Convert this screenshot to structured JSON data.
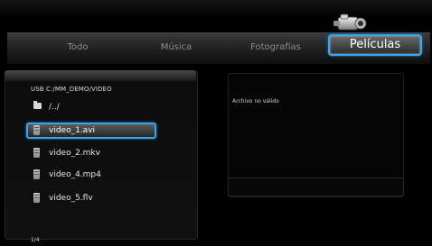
{
  "tabs": [
    {
      "label": "Todo"
    },
    {
      "label": "Música"
    },
    {
      "label": "Fotografías"
    },
    {
      "label": "Películas"
    }
  ],
  "active_tab": "Películas",
  "browser": {
    "path": "USB  C:/MM_DEMO/VIDEO",
    "items": [
      {
        "label": "/../",
        "icon": "folder-icon"
      },
      {
        "label": "video_1.avi",
        "icon": "video-file-icon"
      },
      {
        "label": "video_2.mkv",
        "icon": "video-file-icon"
      },
      {
        "label": "video_4.mp4",
        "icon": "video-file-icon"
      },
      {
        "label": "video_5.flv",
        "icon": "video-file-icon"
      }
    ],
    "selected_item": "video_1.avi",
    "page": "1/4"
  },
  "preview": {
    "status": "Archivo no válido"
  },
  "colors": {
    "accent": "#3ea4e8",
    "background": "#000000"
  }
}
